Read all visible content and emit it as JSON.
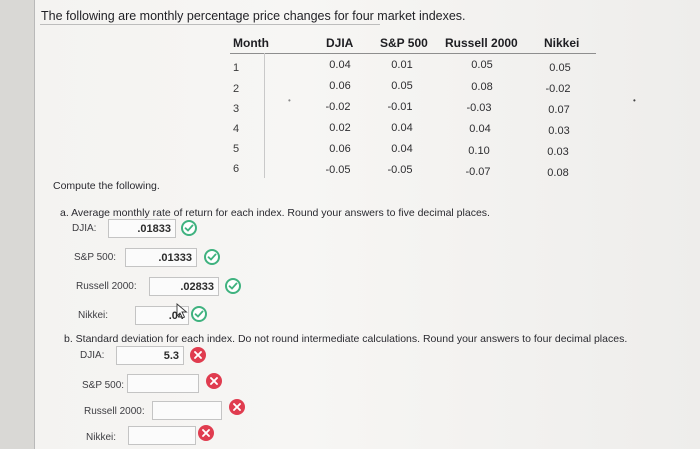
{
  "intro": "The following are monthly percentage price changes for four market indexes.",
  "table": {
    "headers": [
      "Month",
      "DJIA",
      "S&P 500",
      "Russell 2000",
      "Nikkei"
    ],
    "rows": [
      {
        "month": "1",
        "djia": "0.04",
        "sp500": "0.01",
        "russell": "0.05",
        "nikkei": "0.05"
      },
      {
        "month": "2",
        "djia": "0.06",
        "sp500": "0.05",
        "russell": "0.08",
        "nikkei": "-0.02"
      },
      {
        "month": "3",
        "djia": "-0.02",
        "sp500": "-0.01",
        "russell": "-0.03",
        "nikkei": "0.07"
      },
      {
        "month": "4",
        "djia": "0.02",
        "sp500": "0.04",
        "russell": "0.04",
        "nikkei": "0.03"
      },
      {
        "month": "5",
        "djia": "0.06",
        "sp500": "0.04",
        "russell": "0.10",
        "nikkei": "0.03"
      },
      {
        "month": "6",
        "djia": "-0.05",
        "sp500": "-0.05",
        "russell": "-0.07",
        "nikkei": "0.08"
      }
    ]
  },
  "compute": "Compute the following.",
  "part_a": {
    "prompt": "a. Average monthly rate of return for each index. Round your answers to five decimal places.",
    "djia_label": "DJIA:",
    "djia_value": ".01833",
    "sp500_label": "S&P 500:",
    "sp500_value": ".01333",
    "russell_label": "Russell 2000:",
    "russell_value": ".02833",
    "nikkei_label": "Nikkei:",
    "nikkei_value": ".04"
  },
  "part_b": {
    "prompt": "b. Standard deviation for each index. Do not round intermediate calculations. Round your answers to four decimal places.",
    "djia_label": "DJIA:",
    "djia_value": "5.3",
    "sp500_label": "S&P 500:",
    "sp500_value": "",
    "russell_label": "Russell 2000:",
    "russell_value": "",
    "nikkei_label": "Nikkei:",
    "nikkei_value": ""
  },
  "colors": {
    "correct": "#3fb27f",
    "incorrect": "#e03c4f"
  },
  "icons": {
    "correct": "check-circle-icon",
    "incorrect": "x-circle-icon",
    "cursor": "mouse-pointer-icon"
  }
}
